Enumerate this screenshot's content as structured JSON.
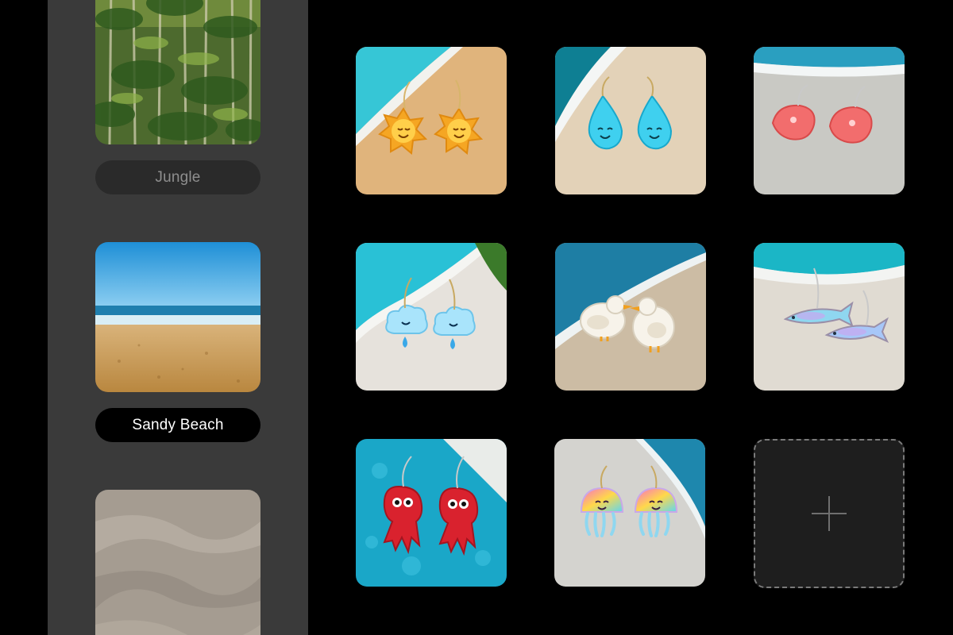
{
  "backgrounds": [
    {
      "label": "Jungle",
      "selected": false
    },
    {
      "label": "Sandy Beach",
      "selected": true
    },
    {
      "label": "",
      "selected": false
    }
  ],
  "designs": [
    {
      "name": "sun-earrings"
    },
    {
      "name": "water-drop-earrings"
    },
    {
      "name": "shrimp-earrings"
    },
    {
      "name": "cloud-earrings"
    },
    {
      "name": "seagull-earrings"
    },
    {
      "name": "fish-earrings"
    },
    {
      "name": "octopus-earrings"
    },
    {
      "name": "jellyfish-earrings"
    }
  ],
  "add_tile": {
    "icon": "plus-icon"
  },
  "colors": {
    "app_bg": "#000000",
    "sidebar_bg": "#3a3a3a",
    "pill_muted_bg": "#2a2a2a",
    "pill_active_bg": "#000000"
  }
}
